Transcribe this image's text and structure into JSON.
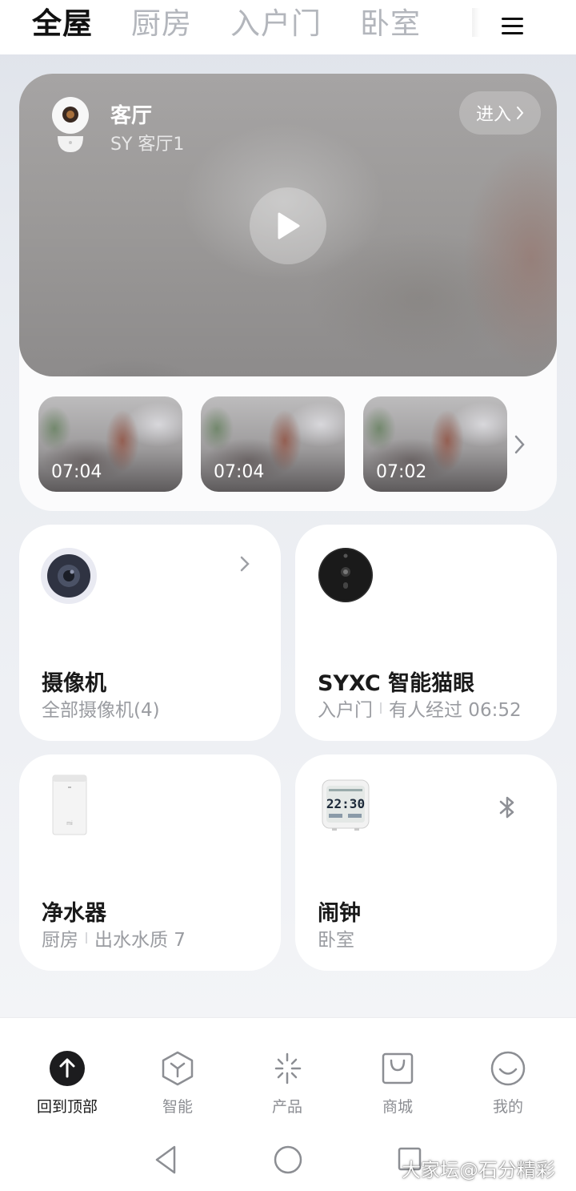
{
  "top_tabs": {
    "items": [
      {
        "label": "全屋",
        "active": true
      },
      {
        "label": "厨房",
        "active": false
      },
      {
        "label": "入户门",
        "active": false
      },
      {
        "label": "卧室",
        "active": false
      }
    ],
    "menu_icon": "hamburger-menu-icon"
  },
  "hero": {
    "title": "客厅",
    "subtitle": "SY 客厅1",
    "enter_label": "进入",
    "play_icon": "play-icon"
  },
  "thumbnails": [
    {
      "time": "07:04"
    },
    {
      "time": "07:04"
    },
    {
      "time": "07:02"
    }
  ],
  "devices": [
    {
      "name": "摄像机",
      "status_parts": [
        "全部摄像机(4)"
      ],
      "icon": "camera-device-icon",
      "badge": "chevron-right-icon"
    },
    {
      "name": "SYXC 智能猫眼",
      "status_parts": [
        "入户门",
        "有人经过 06:52"
      ],
      "icon": "smart-peephole-icon",
      "badge": ""
    },
    {
      "name": "净水器",
      "status_parts": [
        "厨房",
        "出水水质 7"
      ],
      "icon": "water-purifier-icon",
      "badge": "",
      "device_logo": "mi"
    },
    {
      "name": "闹钟",
      "status_parts": [
        "卧室"
      ],
      "icon": "alarm-clock-icon",
      "badge": "bluetooth-icon",
      "clock_display": "22:30"
    }
  ],
  "bottom_nav": [
    {
      "label": "回到顶部",
      "icon": "back-to-top-icon",
      "active": true
    },
    {
      "label": "智能",
      "icon": "smart-cube-icon",
      "active": false
    },
    {
      "label": "产品",
      "icon": "product-sparkle-icon",
      "active": false
    },
    {
      "label": "商城",
      "icon": "shopping-bag-icon",
      "active": false
    },
    {
      "label": "我的",
      "icon": "smiley-profile-icon",
      "active": false
    }
  ],
  "system_nav": [
    "back-triangle-icon",
    "home-circle-icon",
    "recents-square-icon"
  ],
  "watermark": "大家坛@石分精彩",
  "colors": {
    "accent_dark": "#1c1c1e",
    "muted_text": "#9a9ca1",
    "card_bg": "#ffffff"
  }
}
